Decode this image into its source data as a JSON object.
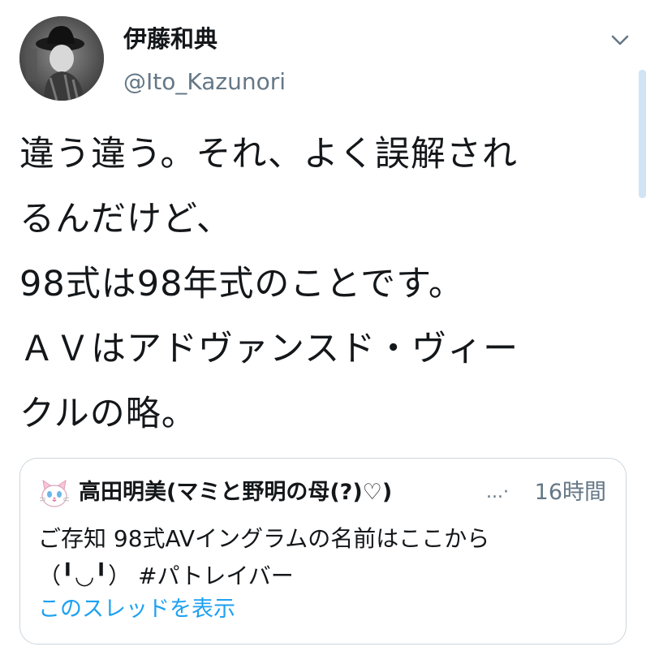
{
  "tweet": {
    "author": {
      "display_name": "伊藤和典",
      "handle": "@Ito_Kazunori",
      "avatar": "avatar-photo"
    },
    "menu_icon": "chevron-down-icon",
    "text": "違う違う。それ、よく誤解され\nるんだけど、\n98式は98年式のことです。\nＡＶはアドヴァンスド・ヴィー\nクルの略。"
  },
  "quoted_tweet": {
    "avatar": "cat-avatar",
    "display_name": "高田明美(マミと野明の母(?)♡)",
    "ellipsis": "...·",
    "time": "16時間",
    "text": "ご存知 98式AVイングラムの名前はここから\n（╹◡╹） #パトレイバー",
    "show_thread": "このスレッドを表示"
  },
  "colors": {
    "text_primary": "#14171a",
    "text_secondary": "#657786",
    "link": "#1da1f2",
    "border": "#ccd6dd"
  }
}
